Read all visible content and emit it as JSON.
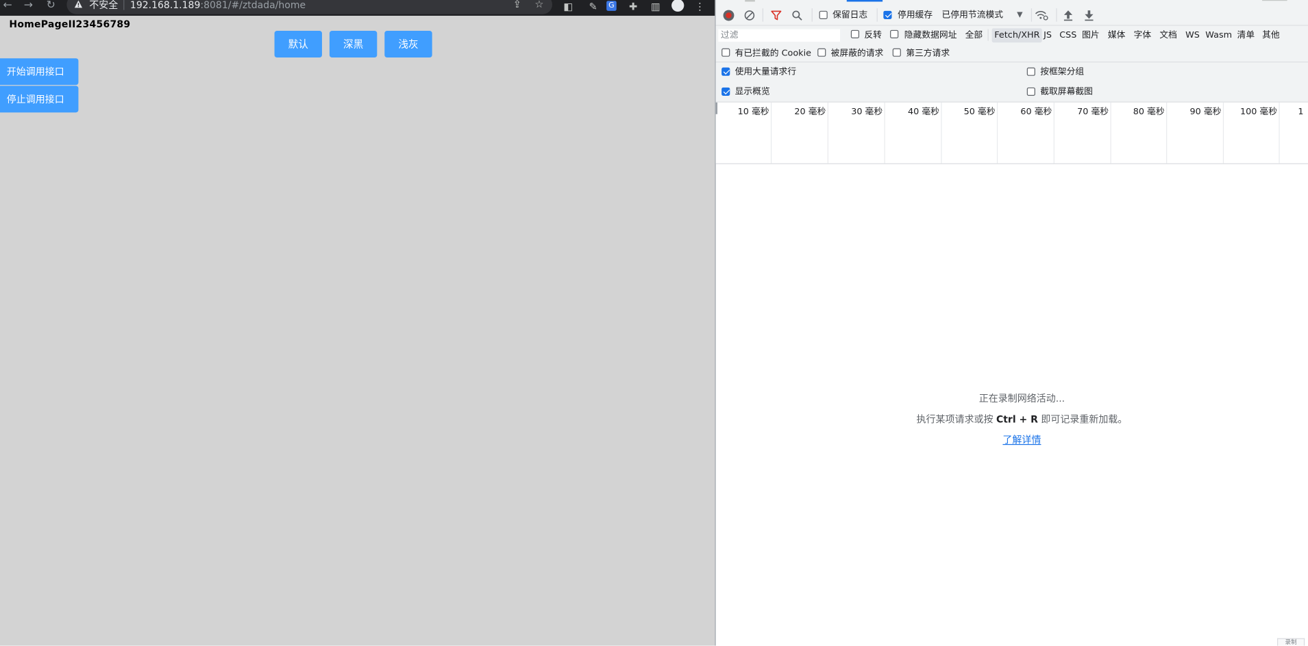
{
  "browser": {
    "security_label": "不安全",
    "url_host": "192.168.1.189",
    "url_rest": ":8081/#/ztdada/home",
    "icons": [
      "back-icon",
      "forward-icon",
      "reload-icon",
      "warning-icon",
      "share-icon",
      "star-icon",
      "extension-icon",
      "puzzle-icon",
      "sidepanel-icon",
      "profile-icon",
      "menu-icon"
    ]
  },
  "page": {
    "title": "HomePageII23456789",
    "theme_buttons": [
      "默认",
      "深黑",
      "浅灰"
    ],
    "start_button": "开始调用接口",
    "stop_button": "停止调用接口",
    "colors": {
      "background": "#d3d3d3",
      "button": "#409eff"
    }
  },
  "devtools": {
    "toolbar": {
      "preserve_log": "保留日志",
      "disable_cache": "停用缓存",
      "throttling": "已停用节流模式"
    },
    "filter": {
      "placeholder": "过滤",
      "invert": "反转",
      "hide_data_urls": "隐藏数据网址",
      "types": [
        "全部",
        "Fetch/XHR",
        "JS",
        "CSS",
        "图片",
        "媒体",
        "字体",
        "文档",
        "WS",
        "Wasm",
        "清单",
        "其他"
      ],
      "active_type": "Fetch/XHR"
    },
    "cookie_filters": {
      "blocked_cookies": "有已拦截的 Cookie",
      "blocked_requests": "被屏蔽的请求",
      "third_party": "第三方请求"
    },
    "settings": {
      "big_rows": "使用大量请求行",
      "group_by_frame": "按框架分组",
      "show_overview": "显示概览",
      "screenshots": "截取屏幕截图"
    },
    "timeline_ticks": [
      "10 毫秒",
      "20 毫秒",
      "30 毫秒",
      "40 毫秒",
      "50 毫秒",
      "60 毫秒",
      "70 毫秒",
      "80 毫秒",
      "90 毫秒",
      "100 毫秒",
      "1"
    ],
    "empty": {
      "line1": "正在录制网络活动...",
      "line2_pre": "执行某项请求或按 ",
      "line2_key": "Ctrl + R",
      "line2_post": " 即可记录重新加载。",
      "link": "了解详情"
    },
    "corner_label": "录制"
  }
}
